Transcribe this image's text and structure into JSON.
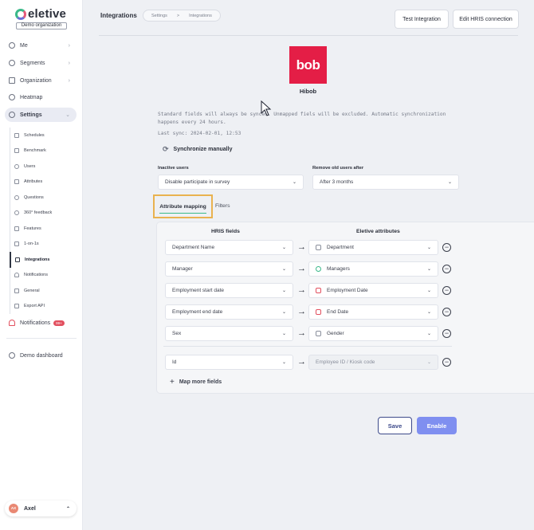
{
  "brand": {
    "name": "eletive",
    "org_label": "Demo organization"
  },
  "sidebar": {
    "top_items": [
      {
        "label": "Me",
        "icon": "user-circle-icon",
        "chevron": "›"
      },
      {
        "label": "Segments",
        "icon": "segments-icon",
        "chevron": "›"
      },
      {
        "label": "Organization",
        "icon": "building-icon",
        "chevron": "›"
      },
      {
        "label": "Heatmap",
        "icon": "heatmap-icon",
        "chevron": ""
      },
      {
        "label": "Settings",
        "icon": "gear-icon",
        "chevron": "⌄"
      }
    ],
    "settings_items": [
      {
        "label": "Schedules",
        "icon": "calendar-icon"
      },
      {
        "label": "Benchmark",
        "icon": "benchmark-icon"
      },
      {
        "label": "Users",
        "icon": "user-icon"
      },
      {
        "label": "Attributes",
        "icon": "tag-icon"
      },
      {
        "label": "Questions",
        "icon": "question-icon"
      },
      {
        "label": "360° feedback",
        "icon": "feedback-icon"
      },
      {
        "label": "Features",
        "icon": "features-icon"
      },
      {
        "label": "1-on-1s",
        "icon": "chat-icon"
      },
      {
        "label": "Integrations",
        "icon": "integrations-icon"
      },
      {
        "label": "Notifications",
        "icon": "bell-icon"
      },
      {
        "label": "General",
        "icon": "sliders-icon"
      },
      {
        "label": "Export API",
        "icon": "export-icon"
      }
    ],
    "notifications": {
      "label": "Notifications",
      "badge": "99+"
    },
    "demo_dashboard": "Demo dashboard",
    "user": {
      "initials": "AX",
      "name": "Axel",
      "chevron": "⌃"
    }
  },
  "header": {
    "title": "Integrations",
    "breadcrumb": [
      "Settings",
      ">",
      "Integrations"
    ],
    "test_button": "Test Integration",
    "edit_button": "Edit HRIS connection"
  },
  "provider": {
    "logo_text": "bob",
    "name": "Hibob",
    "info": "Standard fields will always be synced. Unmapped fiels will be excluded. Automatic synchronization happens every 24 hours.",
    "last_sync": "Last sync: 2024-02-01, 12:53",
    "sync_button": "Synchronize manually"
  },
  "settings": {
    "inactive_label": "Inactive users",
    "inactive_value": "Disable participate in survey",
    "remove_label": "Remove old users after",
    "remove_value": "After 3 months"
  },
  "tabs": {
    "active": "Attribute mapping",
    "other": "Filters"
  },
  "mapping": {
    "hris_header": "HRIS fields",
    "eletive_header": "Eletive attributes",
    "rows": [
      {
        "hris": "Department Name",
        "eletive": "Department",
        "icon_color": "#8a8f9c"
      },
      {
        "hris": "Manager",
        "eletive": "Managers",
        "icon_color": "#3bb98a"
      },
      {
        "hris": "Employment start date",
        "eletive": "Employment Date",
        "icon_color": "#e2505f"
      },
      {
        "hris": "Employment end date",
        "eletive": "End Date",
        "icon_color": "#e2505f"
      },
      {
        "hris": "Sex",
        "eletive": "Gender",
        "icon_color": "#8a8f9c"
      }
    ],
    "fixed_row": {
      "hris": "Id",
      "eletive": "Employee ID / Kiosk code"
    },
    "more_label": "Map more fields"
  },
  "footer": {
    "save": "Save",
    "enable": "Enable"
  },
  "colors": {
    "accent": "#3bb98a",
    "primary": "#7f8ff0",
    "highlight": "#e9b24f",
    "brand_red": "#e41e46"
  }
}
